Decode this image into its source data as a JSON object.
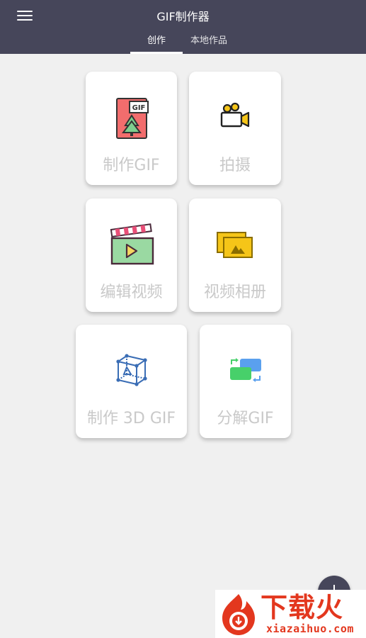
{
  "header": {
    "title": "GIF制作器",
    "tabs": [
      {
        "label": "创作",
        "active": true
      },
      {
        "label": "本地作品",
        "active": false
      }
    ]
  },
  "cards": [
    {
      "label": "制作GIF",
      "icon": "gif-file-icon"
    },
    {
      "label": "拍摄",
      "icon": "video-camera-icon"
    },
    {
      "label": "编辑视频",
      "icon": "clapperboard-icon"
    },
    {
      "label": "视频相册",
      "icon": "photo-album-icon"
    },
    {
      "label": "制作 3D GIF",
      "icon": "3d-cube-icon"
    },
    {
      "label": "分解GIF",
      "icon": "swap-frames-icon"
    }
  ],
  "fab": {
    "icon": "plus-icon"
  },
  "watermark": {
    "text": "下载火",
    "sub": "xiazaihuo.com"
  },
  "colors": {
    "appbar": "#46465a",
    "background": "#f0f0f0",
    "card_label": "#c9c9c9",
    "watermark": "#e3371e"
  }
}
